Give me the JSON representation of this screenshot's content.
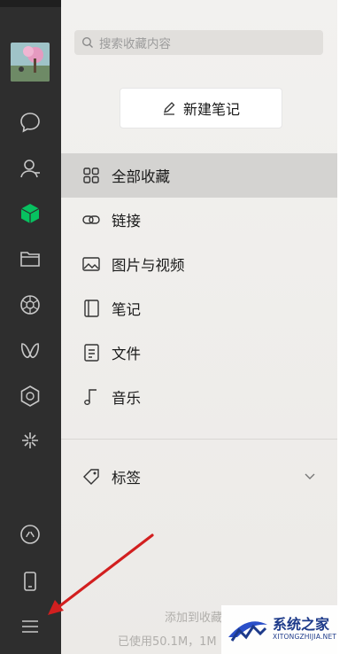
{
  "search": {
    "placeholder": "搜索收藏内容"
  },
  "new_note_label": "新建笔记",
  "nav": [
    {
      "label": "全部收藏",
      "icon": "grid-icon",
      "active": true
    },
    {
      "label": "链接",
      "icon": "link-icon",
      "active": false
    },
    {
      "label": "图片与视频",
      "icon": "image-icon",
      "active": false
    },
    {
      "label": "笔记",
      "icon": "notebook-icon",
      "active": false
    },
    {
      "label": "文件",
      "icon": "file-icon",
      "active": false
    },
    {
      "label": "音乐",
      "icon": "music-icon",
      "active": false
    }
  ],
  "tags": {
    "label": "标签"
  },
  "footer": {
    "line1": "添加到收藏",
    "line2": "已使用50.1M，1M"
  },
  "watermark": {
    "title": "系统之家",
    "sub": "XITONGZHIJIA.NET"
  },
  "colors": {
    "rail": "#2e2e2e",
    "accent_green": "#07c160",
    "panel_bg": "#efeeec",
    "active_bg": "#d4d3d1",
    "arrow": "#d21f1f"
  }
}
